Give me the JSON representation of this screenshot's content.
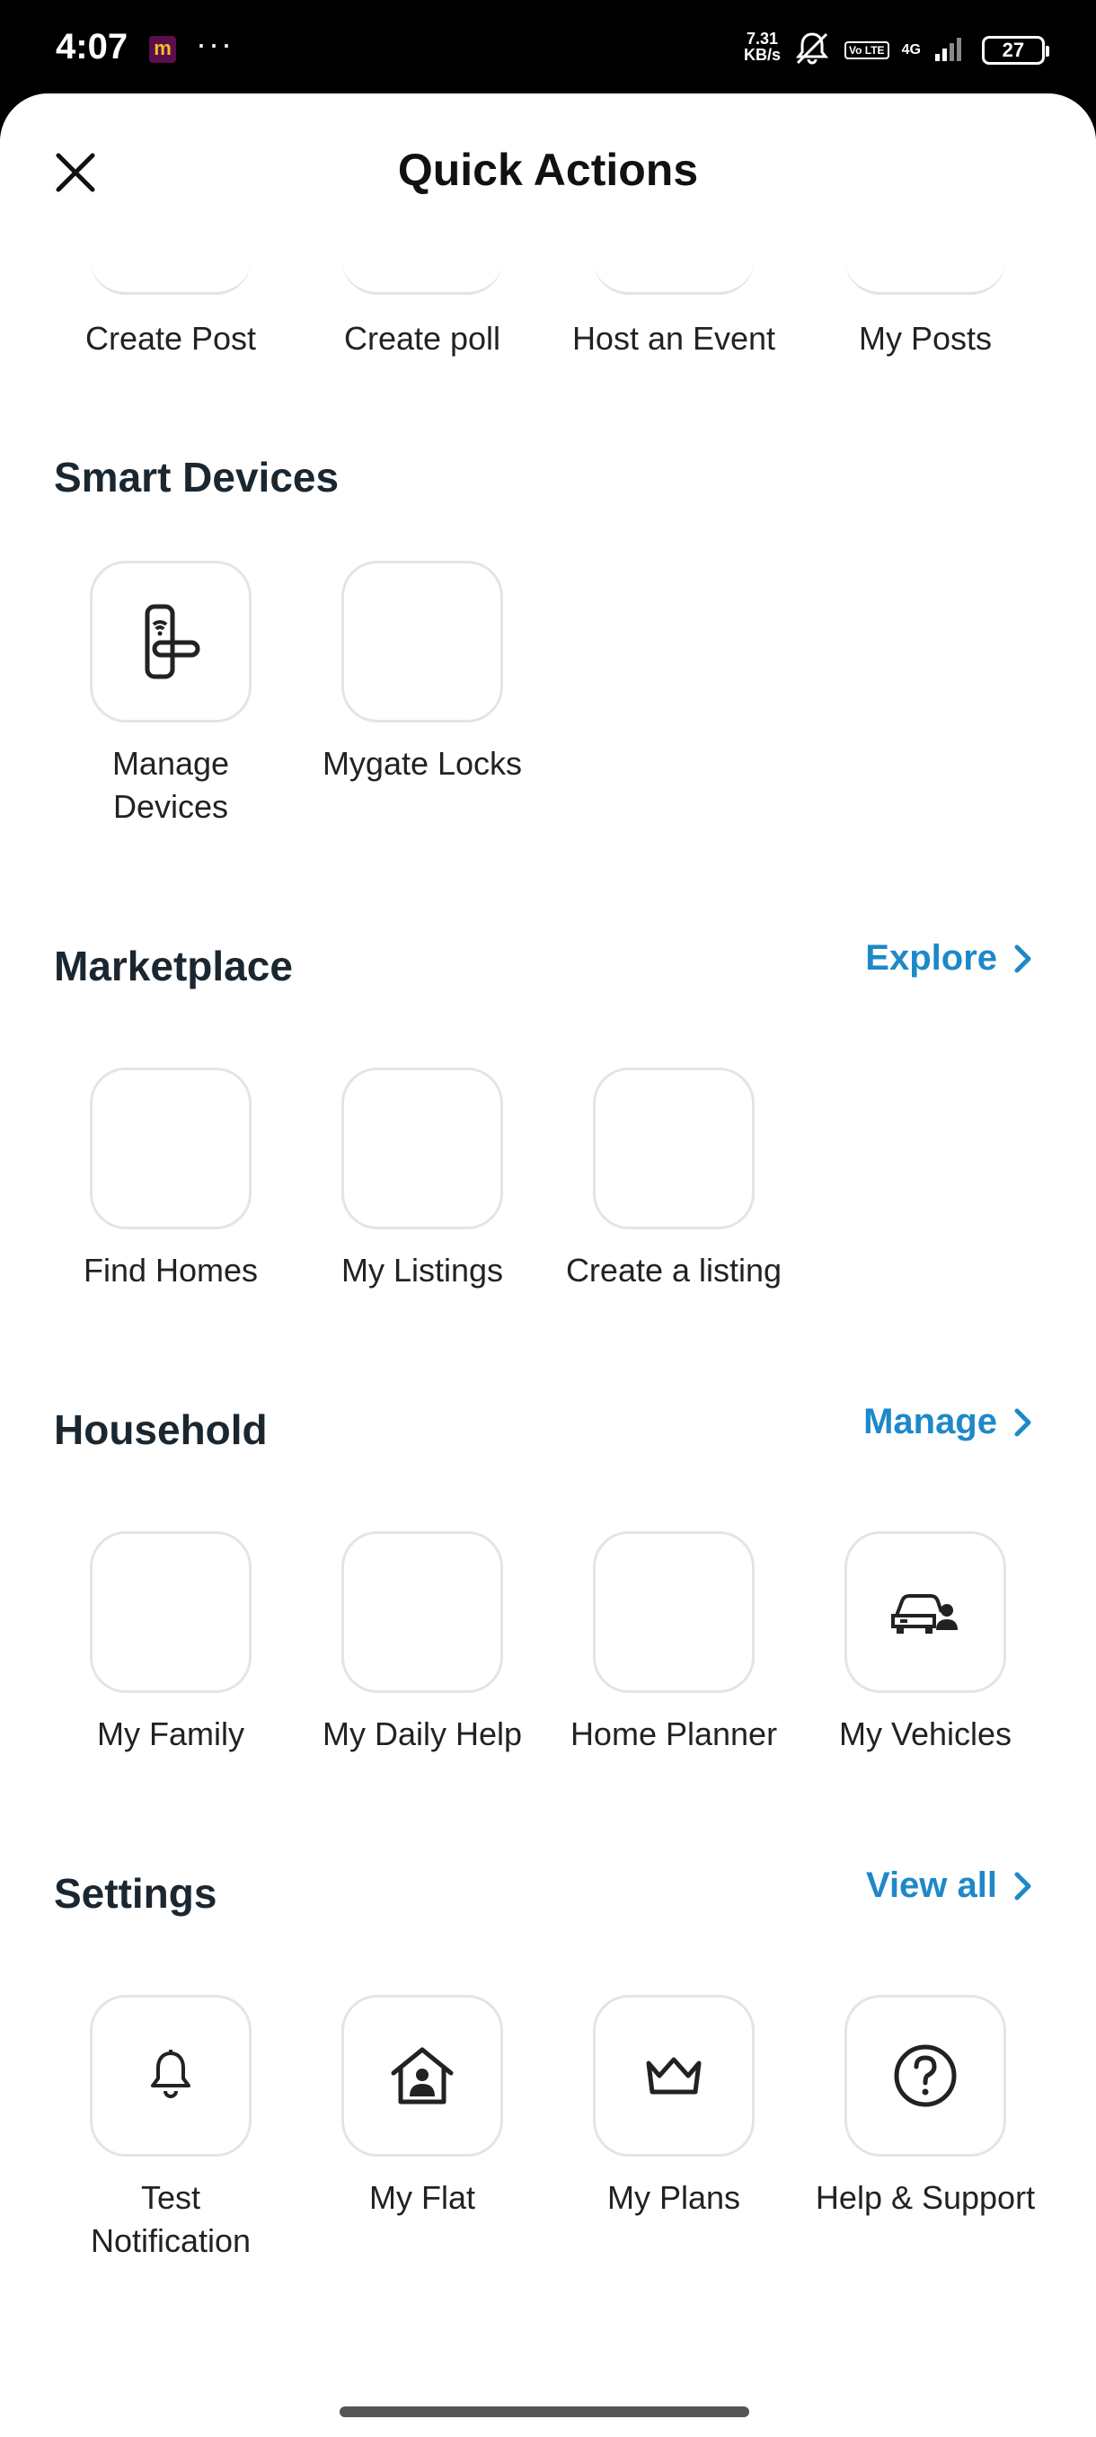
{
  "status_bar": {
    "time": "4:07",
    "app_badge": "m",
    "dots": "···",
    "speed_value": "7.31",
    "speed_unit": "KB/s",
    "volte": "Vo LTE",
    "network": "4G",
    "battery": "27"
  },
  "header": {
    "title": "Quick Actions"
  },
  "top_row": {
    "items": [
      {
        "label": "Create Post"
      },
      {
        "label": "Create poll"
      },
      {
        "label": "Host an Event"
      },
      {
        "label": "My Posts"
      }
    ]
  },
  "smart_devices": {
    "title": "Smart Devices",
    "items": [
      {
        "label_line1": "Manage",
        "label_line2": "Devices",
        "icon": "smart-lock-icon"
      },
      {
        "label_line1": "Mygate Locks",
        "label_line2": "",
        "icon": ""
      }
    ]
  },
  "marketplace": {
    "title": "Marketplace",
    "link": "Explore",
    "items": [
      {
        "label": "Find Homes"
      },
      {
        "label": "My Listings"
      },
      {
        "label": "Create a listing"
      }
    ]
  },
  "household": {
    "title": "Household",
    "link": "Manage",
    "items": [
      {
        "label": "My Family"
      },
      {
        "label": "My Daily Help"
      },
      {
        "label": "Home Planner"
      },
      {
        "label": "My Vehicles",
        "icon": "car-user-icon"
      }
    ]
  },
  "settings": {
    "title": "Settings",
    "link": "View all",
    "items": [
      {
        "label_line1": "Test",
        "label_line2": "Notification",
        "icon": "bell-icon"
      },
      {
        "label_line1": "My Flat",
        "label_line2": "",
        "icon": "home-user-icon"
      },
      {
        "label_line1": "My Plans",
        "label_line2": "",
        "icon": "crown-icon"
      },
      {
        "label_line1": "Help & Support",
        "label_line2": "",
        "icon": "help-circle-icon"
      }
    ]
  },
  "colors": {
    "accent": "#1e88c8",
    "heading": "#1b2730",
    "tile_border": "#e4e4e4"
  }
}
